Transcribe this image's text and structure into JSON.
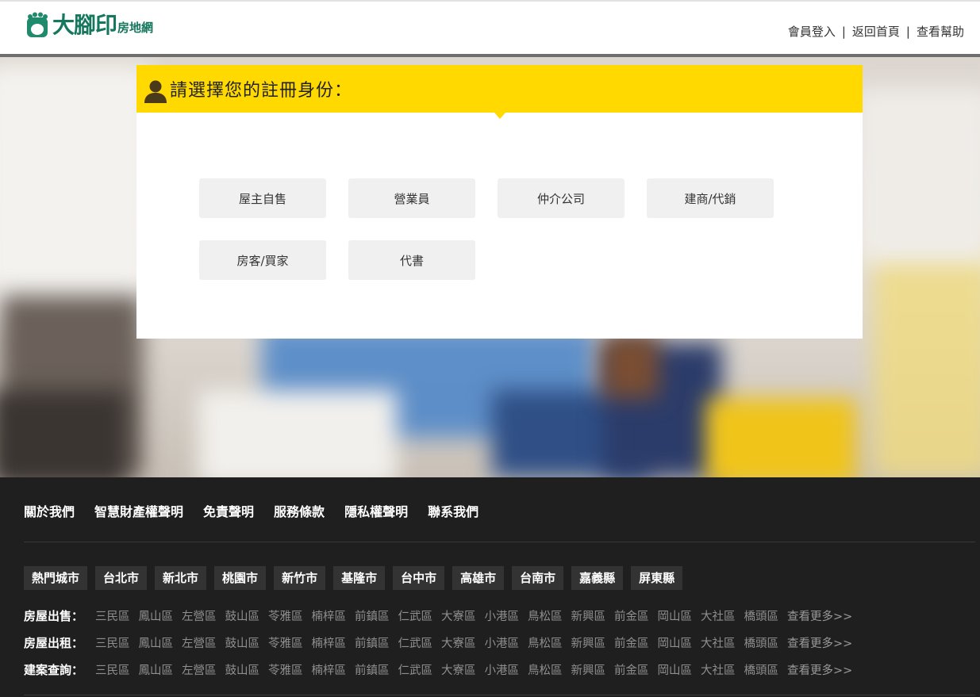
{
  "brand": {
    "name": "大腳印",
    "sub": "房地網",
    "accent_color": "#15775d"
  },
  "top_nav": {
    "login": "會員登入",
    "home": "返回首頁",
    "help": "查看幫助",
    "separator": "|"
  },
  "register": {
    "title": "請選擇您的註冊身份：",
    "header_color": "#ffd900",
    "roles": [
      "屋主自售",
      "營業員",
      "仲介公司",
      "建商/代銷",
      "房客/買家",
      "代書"
    ]
  },
  "footer": {
    "links": [
      "關於我們",
      "智慧財產權聲明",
      "免責聲明",
      "服務條款",
      "隱私權聲明",
      "聯系我們"
    ],
    "cities": [
      "熱門城市",
      "台北市",
      "新北市",
      "桃園市",
      "新竹市",
      "基隆市",
      "台中市",
      "高雄市",
      "台南市",
      "嘉義縣",
      "屏東縣"
    ],
    "district_rows": [
      {
        "label": "房屋出售：",
        "districts": [
          "三民區",
          "鳳山區",
          "左營區",
          "鼓山區",
          "苓雅區",
          "楠梓區",
          "前鎮區",
          "仁武區",
          "大寮區",
          "小港區",
          "鳥松區",
          "新興區",
          "前金區",
          "岡山區",
          "大社區",
          "橋頭區"
        ],
        "more": "查看更多>>"
      },
      {
        "label": "房屋出租：",
        "districts": [
          "三民區",
          "鳳山區",
          "左營區",
          "鼓山區",
          "苓雅區",
          "楠梓區",
          "前鎮區",
          "仁武區",
          "大寮區",
          "小港區",
          "鳥松區",
          "新興區",
          "前金區",
          "岡山區",
          "大社區",
          "橋頭區"
        ],
        "more": "查看更多>>"
      },
      {
        "label": "建案查詢：",
        "districts": [
          "三民區",
          "鳳山區",
          "左營區",
          "鼓山區",
          "苓雅區",
          "楠梓區",
          "前鎮區",
          "仁武區",
          "大寮區",
          "小港區",
          "鳥松區",
          "新興區",
          "前金區",
          "岡山區",
          "大社區",
          "橋頭區"
        ],
        "more": "查看更多>>"
      }
    ]
  }
}
